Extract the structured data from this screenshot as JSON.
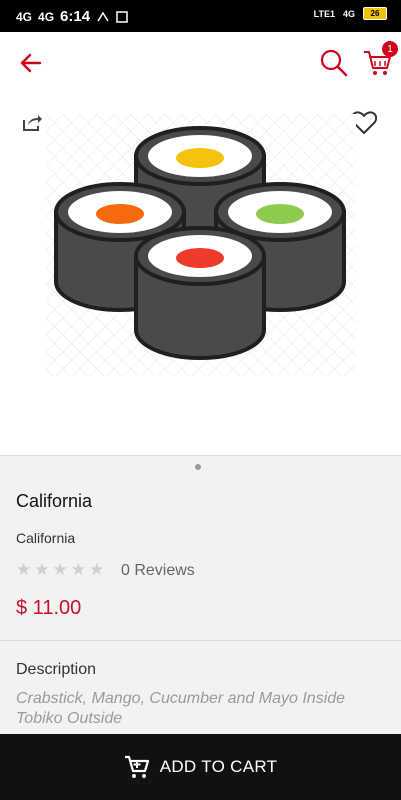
{
  "status": {
    "left_network_1": "4G",
    "left_network_2": "4G",
    "time": "6:14",
    "right_network": "LTE1",
    "right_4g": "4G",
    "battery": "26"
  },
  "appbar": {
    "cart_count": "1",
    "colors": {
      "accent": "#d0021b"
    },
    "icons": [
      "back-arrow-icon",
      "search-icon",
      "cart-icon"
    ]
  },
  "product": {
    "name": "California",
    "subtitle": "California",
    "rating": 0,
    "stars_total": 5,
    "reviews": "0 Reviews",
    "price": "$ 11.00"
  },
  "description": {
    "heading": "Description",
    "text": "Crabstick, Mango, Cucumber and Mayo Inside Tobiko Outside"
  },
  "actions": {
    "add_to_cart": "ADD TO CART"
  }
}
